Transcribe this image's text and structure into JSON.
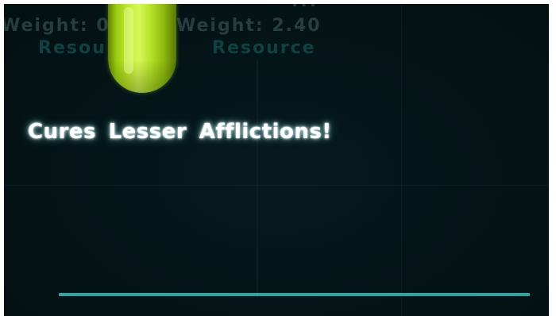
{
  "hud": {
    "top_fragment": "...",
    "weight_left": "Weight: 0",
    "weight_right": "Weight: 2.40",
    "resource_left": "Resou",
    "resource_right": "Resource"
  },
  "item": {
    "icon": "green-vial-icon",
    "effect_text": "Cures Lesser Afflictions!"
  },
  "progress": {
    "fraction": 1.0
  },
  "colors": {
    "background": "#041417",
    "vial": "#b8e22a",
    "progress": "#2aa8a8",
    "effect_text": "#ffffff"
  }
}
